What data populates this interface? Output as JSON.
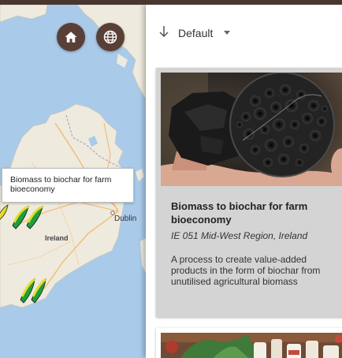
{
  "map": {
    "tooltip": "Biomass to biochar for farm bioeconomy",
    "places": {
      "dublin": "Dublin",
      "ireland": "Ireland"
    },
    "buttons": {
      "home": "home-icon",
      "globe": "globe-icon"
    },
    "colors": {
      "sea": "#a9cbe9",
      "land": "#eeeadd",
      "button": "#5a3f37"
    }
  },
  "sort": {
    "label": "Default"
  },
  "cards": [
    {
      "title": "Biomass to biochar for farm bioeconomy",
      "location": "IE 051 Mid-West Region, Ireland",
      "description": "A process to create value-added products in the form of biochar from unutilised agricultural biomass"
    }
  ]
}
